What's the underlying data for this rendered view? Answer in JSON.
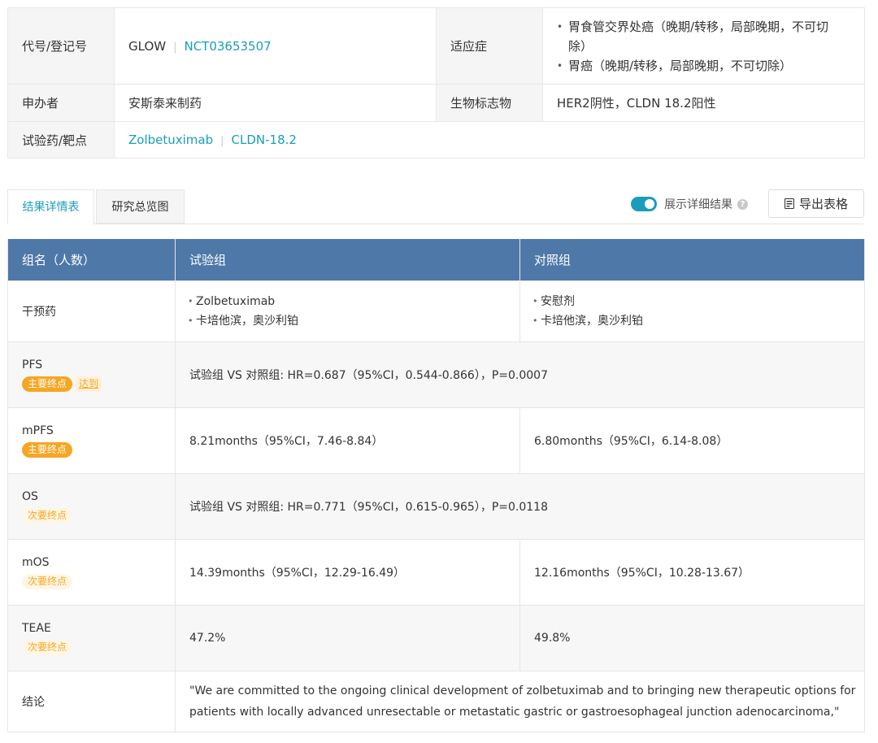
{
  "info": {
    "code_label": "代号/登记号",
    "code_value": "GLOW",
    "code_id": "NCT03653507",
    "indication_label": "适应症",
    "indications": [
      "胃食管交界处癌（晚期/转移，局部晚期，不可切除）",
      "胃癌（晚期/转移，局部晚期，不可切除）"
    ],
    "sponsor_label": "申办者",
    "sponsor_value": "安斯泰来制药",
    "biomarker_label": "生物标志物",
    "biomarker_value": "HER2阴性，CLDN 18.2阳性",
    "drug_label": "试验药/靶点",
    "drug_name": "Zolbetuximab",
    "drug_target": "CLDN-18.2"
  },
  "tabs": {
    "active": "结果详情表",
    "inactive": "研究总览图"
  },
  "toolbar": {
    "toggle_label": "展示详细结果",
    "help_icon": "?",
    "export_label": "导出表格"
  },
  "table": {
    "headers": [
      "组名（人数）",
      "试验组",
      "对照组"
    ],
    "intervention_label": "干预药",
    "exp_interventions": [
      "Zolbetuximab",
      "卡培他滨，奥沙利铂"
    ],
    "ctl_interventions": [
      "安慰剂",
      "卡培他滨，奥沙利铂"
    ],
    "rows": {
      "pfs": {
        "name": "PFS",
        "badge": "主要终点",
        "status": "达到",
        "value": "试验组 VS 对照组: HR=0.687（95%CI，0.544-0.866），P=0.0007"
      },
      "mpfs": {
        "name": "mPFS",
        "badge": "主要终点",
        "exp": "8.21months（95%CI，7.46-8.84）",
        "ctl": "6.80months（95%CI，6.14-8.08）"
      },
      "os": {
        "name": "OS",
        "badge": "次要终点",
        "value": "试验组 VS 对照组: HR=0.771（95%CI，0.615-0.965），P=0.0118"
      },
      "mos": {
        "name": "mOS",
        "badge": "次要终点",
        "exp": "14.39months（95%CI，12.29-16.49）",
        "ctl": "12.16months（95%CI，10.28-13.67）"
      },
      "teae": {
        "name": "TEAE",
        "badge": "次要终点",
        "exp": "47.2%",
        "ctl": "49.8%"
      },
      "conclusion": {
        "name": "结论",
        "value": "\"We are committed to the ongoing clinical development of zolbetuximab and to bringing new therapeutic options for patients with locally advanced unresectable or metastatic gastric or gastroesophageal junction adenocarcinoma,\""
      }
    }
  }
}
